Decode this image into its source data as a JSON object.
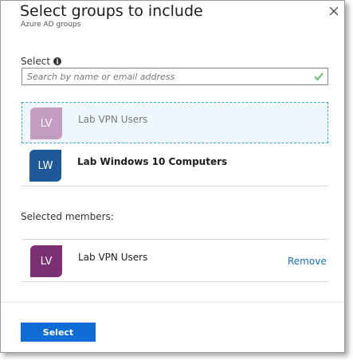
{
  "header": {
    "title": "Select groups to include",
    "subtitle": "Azure AD groups"
  },
  "search": {
    "label": "Select",
    "placeholder": "Search by name or email address"
  },
  "results": [
    {
      "initials": "LV",
      "name": "Lab VPN Users",
      "avatar_color": "#c49cc0",
      "name_color": "#7a7a7a",
      "selected": true
    },
    {
      "initials": "LW",
      "name": "Lab Windows 10 Computers",
      "avatar_color": "#1e5a9a",
      "name_color": "#1e1e1e",
      "selected": false
    }
  ],
  "selected_members": {
    "label": "Selected members:",
    "items": [
      {
        "initials": "LV",
        "name": "Lab VPN Users",
        "avatar_color": "#7b2f74",
        "remove_label": "Remove"
      }
    ]
  },
  "footer": {
    "select_label": "Select"
  },
  "colors": {
    "accent": "#0f6cd6",
    "link": "#1a6fb8",
    "valid_check": "#5cb85c",
    "selection_border": "#3aa8c8"
  }
}
